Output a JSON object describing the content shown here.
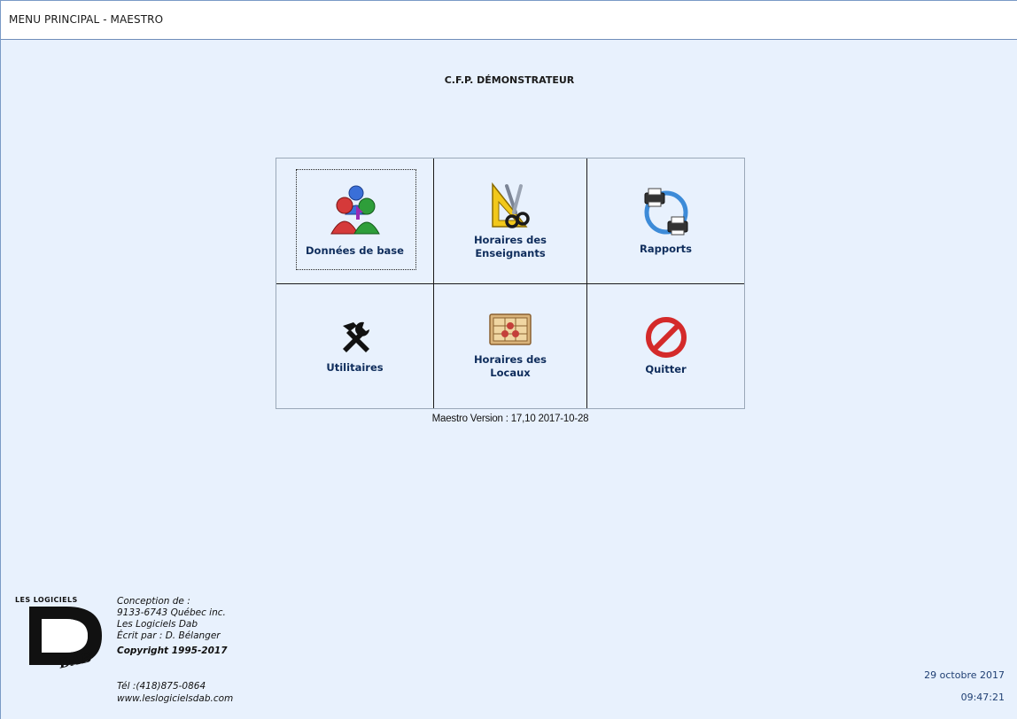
{
  "window": {
    "title": "MENU PRINCIPAL - MAESTRO"
  },
  "header": {
    "organization": "C.F.P. DÉMONSTRATEUR"
  },
  "menu": {
    "items": [
      {
        "label_line1": "Données de base",
        "label_line2": "",
        "icon": "users-group-icon"
      },
      {
        "label_line1": "Horaires des",
        "label_line2": "Enseignants",
        "icon": "scissors-triangle-icon"
      },
      {
        "label_line1": "Rapports",
        "label_line2": "",
        "icon": "printer-cycle-icon"
      },
      {
        "label_line1": "Utilitaires",
        "label_line2": "",
        "icon": "tools-icon"
      },
      {
        "label_line1": "Horaires des",
        "label_line2": "Locaux",
        "icon": "room-board-icon"
      },
      {
        "label_line1": "Quitter",
        "label_line2": "",
        "icon": "stop-sign-icon"
      }
    ]
  },
  "footer": {
    "version": "Maestro Version : 17,10  2017-10-28",
    "logo_caption": "LES LOGICIELS",
    "logo_text": "DAB",
    "credits": {
      "line1": "Conception de :",
      "line2": "9133-6743 Québec inc.",
      "line3": "Les Logiciels Dab",
      "line4": "Écrit par : D. Bélanger",
      "copyright": "Copyright 1995-2017"
    },
    "contact": {
      "phone": "Tél :(418)875-0864",
      "website": "www.leslogicielsdab.com"
    },
    "date": "29 octobre 2017",
    "time": "09:47:21"
  },
  "colors": {
    "background": "#e8f1fd",
    "label": "#0f2d5c",
    "date_text": "#1f3f73"
  }
}
